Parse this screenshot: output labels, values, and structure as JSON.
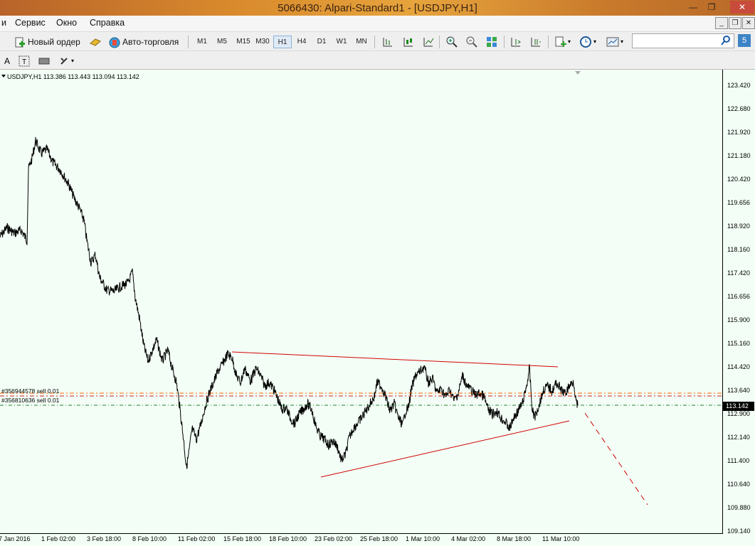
{
  "window": {
    "title": "5066430: Alpari-Standard1 - [USDJPY,H1]",
    "controls": [
      "—",
      "❐",
      "✕"
    ]
  },
  "menu": {
    "items": [
      "и",
      "Сервис",
      "Окно",
      "Справка"
    ]
  },
  "toolbar": {
    "new_order": "Новый ордер",
    "auto_trading": "Авто-торговля",
    "timeframes": [
      "M1",
      "M5",
      "M15",
      "M30",
      "H1",
      "H4",
      "D1",
      "W1",
      "MN"
    ],
    "active_timeframe": "H1",
    "notification_badge": "5"
  },
  "chart": {
    "header": "USDJPY,H1  113.386 113.443 113.094 113.142",
    "price_ticks": [
      "123.420",
      "122.680",
      "121.920",
      "121.180",
      "120.420",
      "119.656",
      "118.920",
      "118.160",
      "117.420",
      "116.656",
      "115.900",
      "115.160",
      "114.420",
      "113.640",
      "112.900",
      "112.140",
      "111.400",
      "110.640",
      "109.880",
      "109.140"
    ],
    "current_price": "113.142",
    "time_ticks": [
      "7 Jan 2016",
      "1 Feb 02:00",
      "3 Feb 18:00",
      "8 Feb 10:00",
      "11 Feb 02:00",
      "15 Feb 18:00",
      "18 Feb 10:00",
      "23 Feb 02:00",
      "25 Feb 18:00",
      "1 Mar 10:00",
      "4 Mar 02:00",
      "8 Mar 18:00",
      "11 Mar 10:00"
    ],
    "orders": [
      "#356944578 sell 0.01",
      "#356810636 sell 0.01"
    ],
    "colors": {
      "background": "#f3fff6",
      "price_line": "#000000",
      "trendline": "#d40000",
      "order_line_1": "#ff6600",
      "order_line_2": "#cc2222",
      "current_line": "#2e7d32"
    }
  }
}
